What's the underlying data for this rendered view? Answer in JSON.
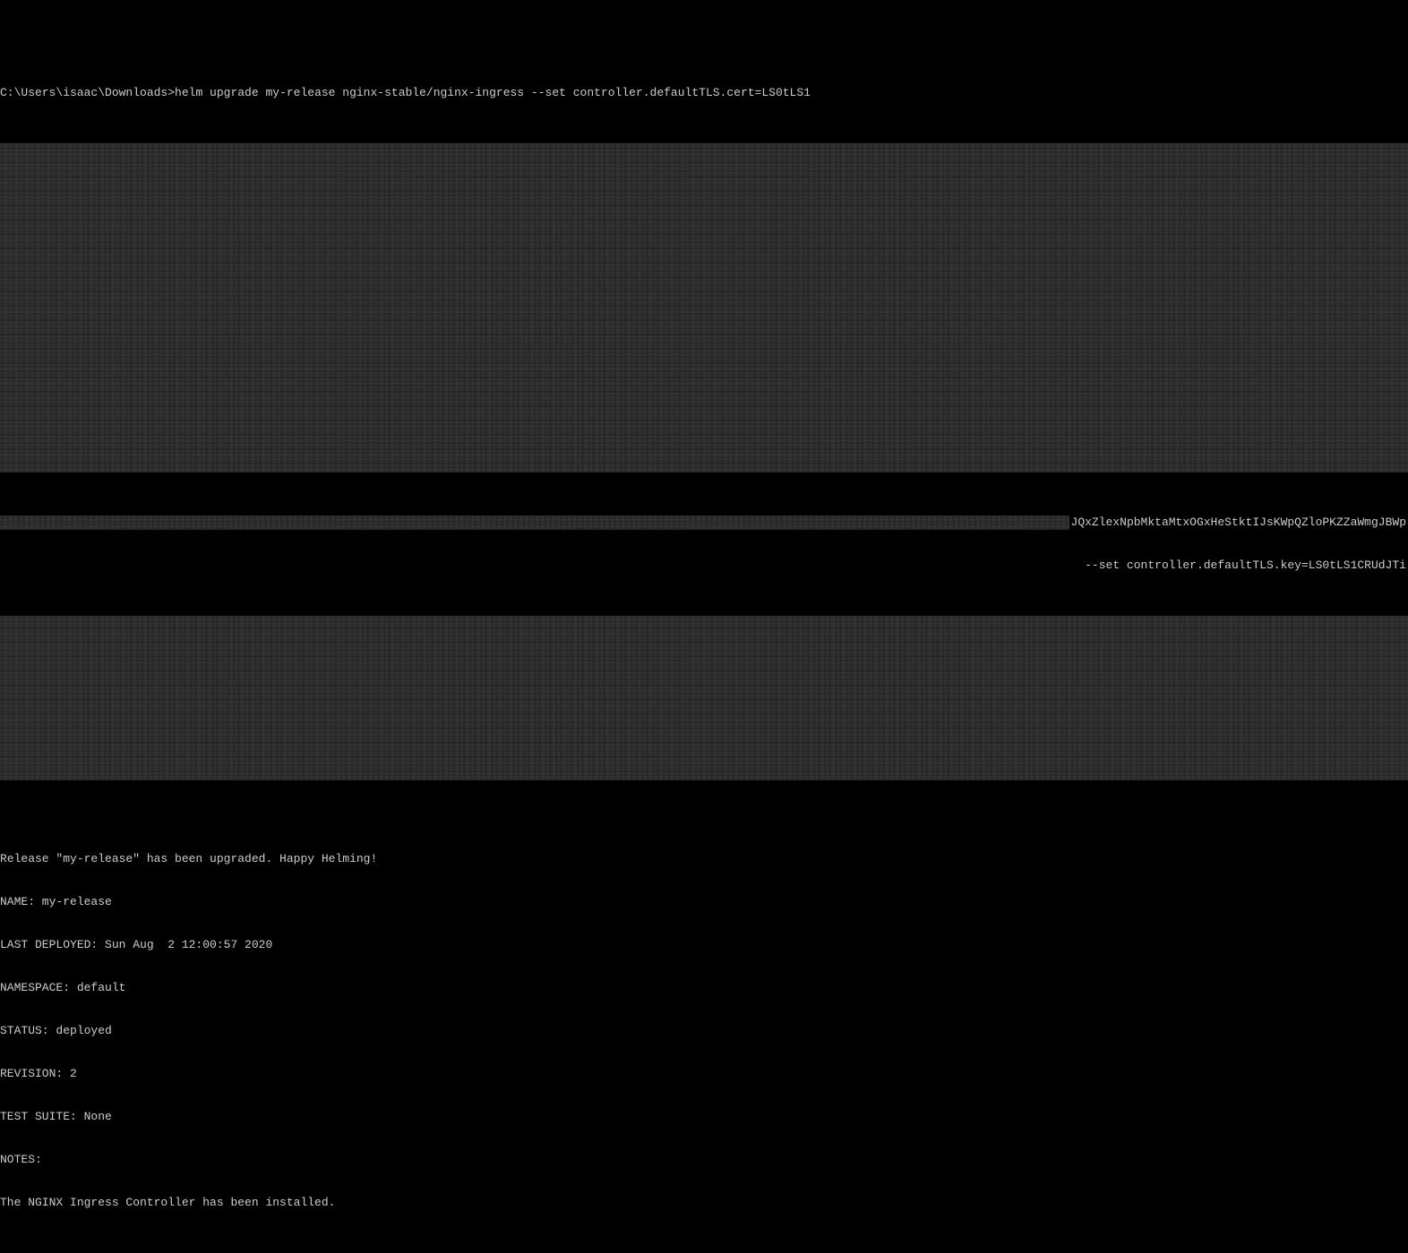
{
  "prompt": {
    "path": "C:\\Users\\isaac\\Downloads>",
    "command": "helm upgrade my-release nginx-stable/nginx-ingress --set controller.defaultTLS.cert=LS0tLS1"
  },
  "mid_line_1": "JQxZlexNpbMktaMtxOGxHeStktIJsKWpQZloPKZZaWmgJBWp",
  "mid_line_2": " --set controller.defaultTLS.key=LS0tLS1CRUdJTi",
  "output": {
    "release_msg": "Release \"my-release\" has been upgraded. Happy Helming!",
    "name_line": "NAME: my-release",
    "last_deployed_line": "LAST DEPLOYED: Sun Aug  2 12:00:57 2020",
    "namespace_line": "NAMESPACE: default",
    "status_line": "STATUS: deployed",
    "revision_line": "REVISION: 2",
    "test_suite_line": "TEST SUITE: None",
    "notes_label": "NOTES:",
    "notes_body": "The NGINX Ingress Controller has been installed."
  }
}
